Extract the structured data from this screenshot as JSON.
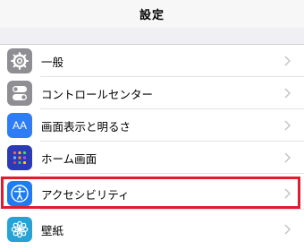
{
  "header": {
    "title": "設定"
  },
  "settings": {
    "items": [
      {
        "label": "一般",
        "icon": "gear-icon",
        "color": "#8e8e93"
      },
      {
        "label": "コントロールセンター",
        "icon": "toggles-icon",
        "color": "#8e8e93"
      },
      {
        "label": "画面表示と明るさ",
        "icon": "text-size-icon",
        "color": "#2f7df6",
        "glyph": "AA"
      },
      {
        "label": "ホーム画面",
        "icon": "home-grid-icon",
        "color": "#2c3bb5"
      },
      {
        "label": "アクセシビリティ",
        "icon": "accessibility-icon",
        "color": "#1d7cf2"
      },
      {
        "label": "壁紙",
        "icon": "wallpaper-flower-icon",
        "color": "#27a2d6"
      }
    ]
  },
  "colors": {
    "highlight": "#e01c2e"
  }
}
